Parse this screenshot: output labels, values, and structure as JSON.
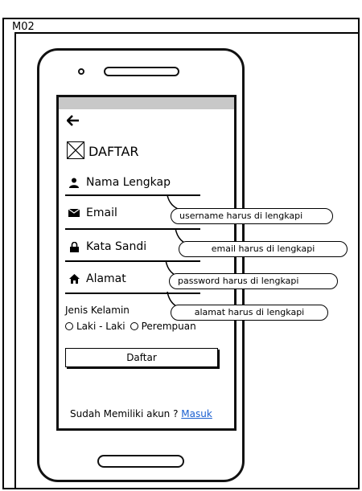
{
  "frame": {
    "title": "M02"
  },
  "screen": {
    "back_icon": "arrow-left-icon",
    "title": "DAFTAR",
    "fields": [
      {
        "label": "Nama Lengkap",
        "icon": "user-icon"
      },
      {
        "label": "Email",
        "icon": "envelope-icon"
      },
      {
        "label": "Kata Sandi",
        "icon": "lock-icon"
      },
      {
        "label": "Alamat",
        "icon": "home-icon"
      }
    ],
    "gender": {
      "label": "Jenis Kelamin",
      "options": [
        "Laki - Laki",
        "Perempuan"
      ]
    },
    "submit_label": "Daftar",
    "login_prompt": "Sudah Memiliki akun ?",
    "login_link": "Masuk"
  },
  "annotations": [
    "username harus di lengkapi",
    "email harus di lengkapi",
    "password harus di lengkapi",
    "alamat harus di lengkapi"
  ]
}
